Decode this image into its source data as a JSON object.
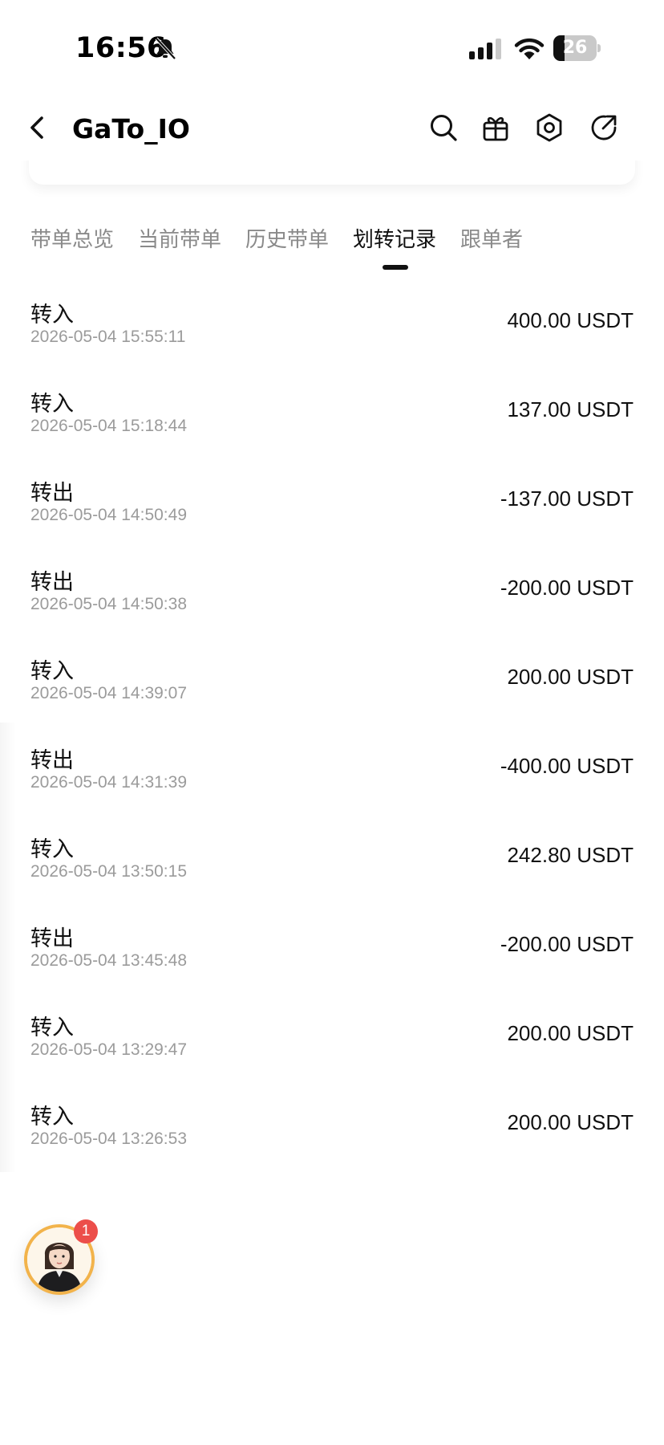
{
  "status_bar": {
    "time": "16:56",
    "battery_level": "26",
    "battery_percent": 26
  },
  "header": {
    "title": "GaTo_IO",
    "icons": [
      "chevron-left-icon",
      "search-icon",
      "gift-icon",
      "hexagon-settings-icon",
      "share-icon"
    ]
  },
  "tabs": [
    {
      "label": "带单总览",
      "active": false
    },
    {
      "label": "当前带单",
      "active": false
    },
    {
      "label": "历史带单",
      "active": false
    },
    {
      "label": "划转记录",
      "active": true
    },
    {
      "label": "跟单者",
      "active": false
    }
  ],
  "transfers": [
    {
      "type": "转入",
      "time": "2026-05-04 15:55:11",
      "amount": "400.00 USDT"
    },
    {
      "type": "转入",
      "time": "2026-05-04 15:18:44",
      "amount": "137.00 USDT"
    },
    {
      "type": "转出",
      "time": "2026-05-04 14:50:49",
      "amount": "-137.00 USDT"
    },
    {
      "type": "转出",
      "time": "2026-05-04 14:50:38",
      "amount": "-200.00 USDT"
    },
    {
      "type": "转入",
      "time": "2026-05-04 14:39:07",
      "amount": "200.00 USDT"
    },
    {
      "type": "转出",
      "time": "2026-05-04 14:31:39",
      "amount": "-400.00 USDT"
    },
    {
      "type": "转入",
      "time": "2026-05-04 13:50:15",
      "amount": "242.80 USDT"
    },
    {
      "type": "转出",
      "time": "2026-05-04 13:45:48",
      "amount": "-200.00 USDT"
    },
    {
      "type": "转入",
      "time": "2026-05-04 13:29:47",
      "amount": "200.00 USDT"
    },
    {
      "type": "转入",
      "time": "2026-05-04 13:26:53",
      "amount": "200.00 USDT"
    }
  ],
  "support": {
    "badge_count": "1",
    "icon": "customer-service-avatar"
  },
  "colors": {
    "badge": "#ec4e4a",
    "support_ring": "#f2b34b",
    "muted_text": "#9b9b9b"
  }
}
